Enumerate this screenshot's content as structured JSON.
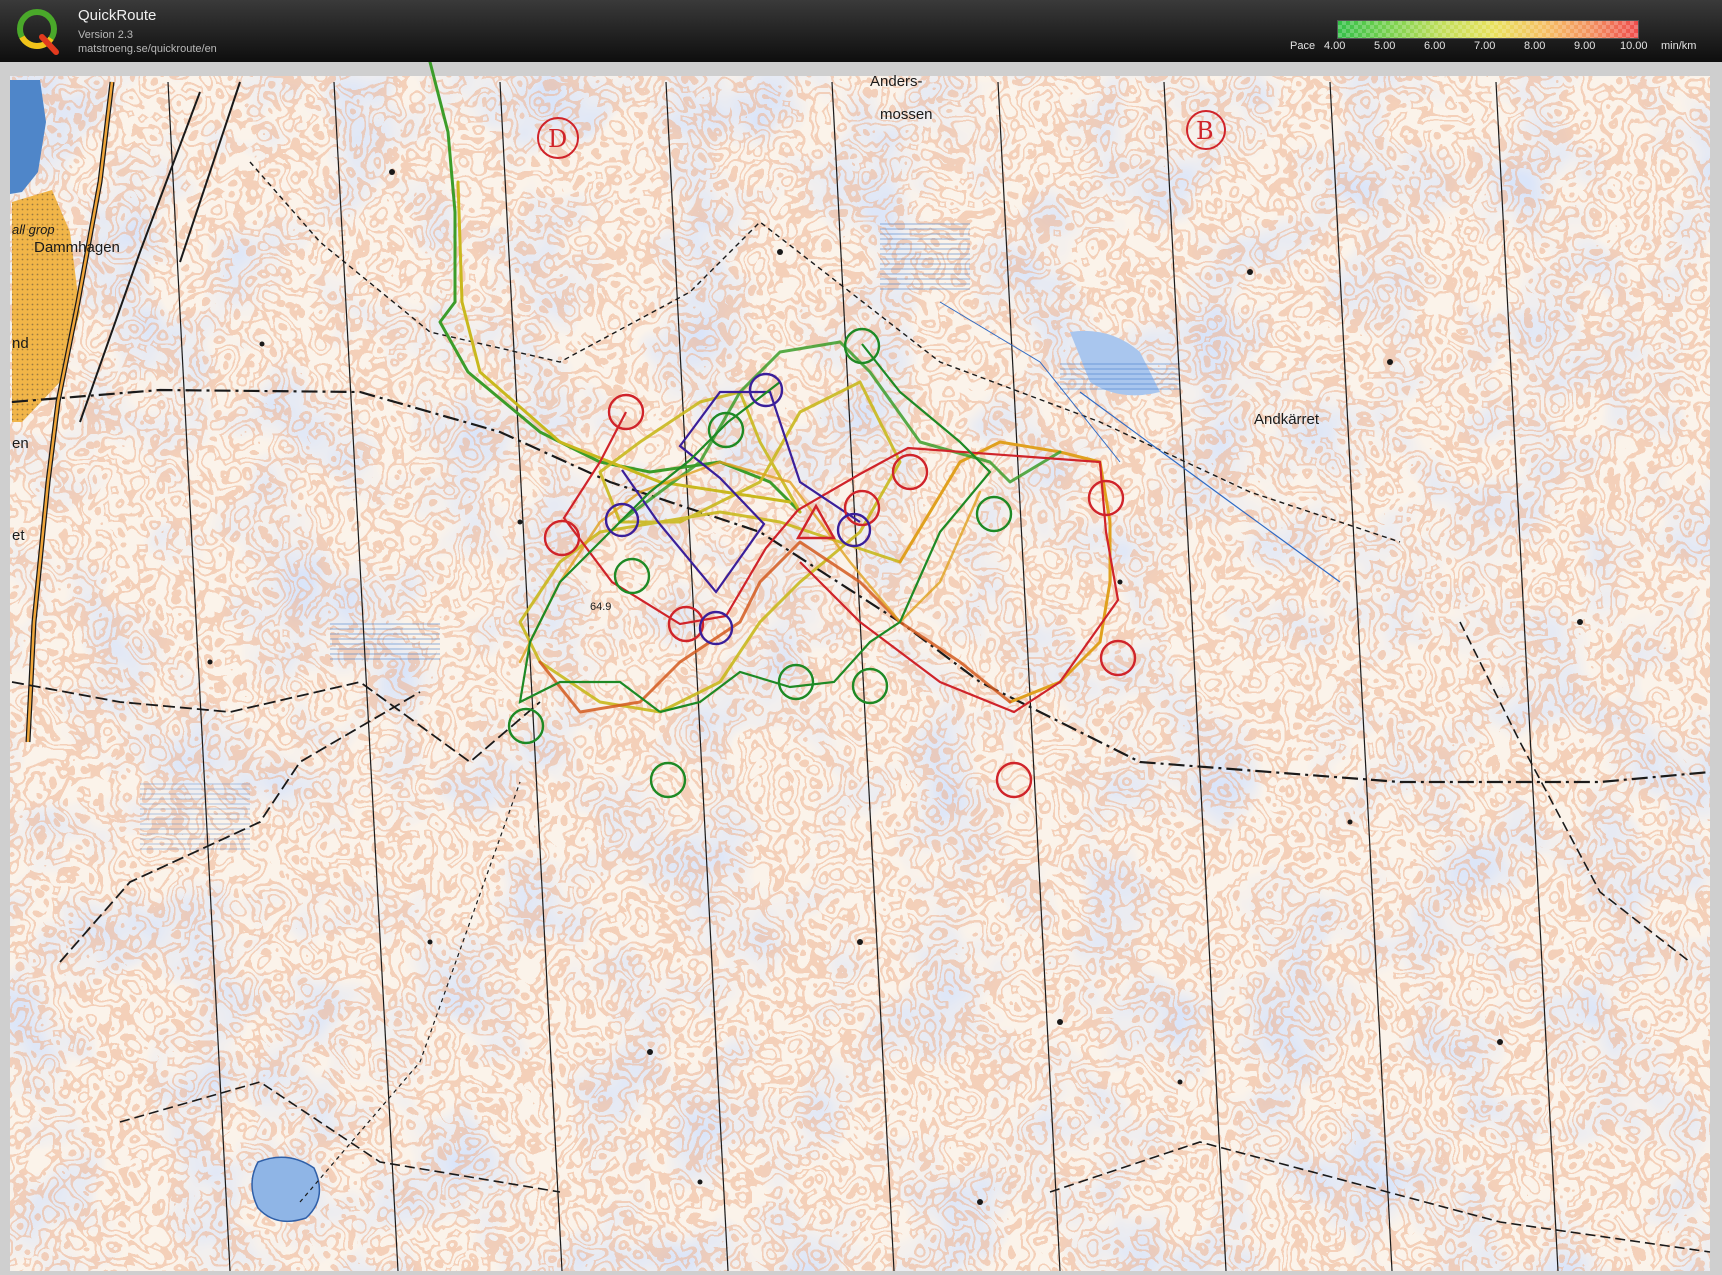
{
  "app": {
    "title": "QuickRoute",
    "version": "Version 2.3",
    "url": "matstroeng.se/quickroute/en",
    "logo_letter": "Q"
  },
  "pace_legend": {
    "label": "Pace",
    "ticks": [
      "4.00",
      "5.00",
      "6.00",
      "7.00",
      "8.00",
      "9.00",
      "10.00"
    ],
    "unit": "min/km",
    "color_fast": "#34c049",
    "color_slow": "#ee4c4c"
  },
  "map": {
    "labels": {
      "anders_1": "Anders-",
      "anders_2": "mossen",
      "andkarret": "Andkärret",
      "dammhagen": "Dammhagen",
      "grop": "all grop",
      "height": "64.9",
      "edge_nd": "nd",
      "edge_en": "en",
      "edge_et": "et"
    },
    "handwritten": {
      "area_d": "D",
      "area_b": "B"
    },
    "course_colors": {
      "red": "#d0242a",
      "green": "#1e8a25",
      "purple": "#3b1f9a"
    },
    "track_colors": [
      "#c9b81d",
      "#3c9d2a",
      "#e0a01e",
      "#d45a1e"
    ]
  }
}
